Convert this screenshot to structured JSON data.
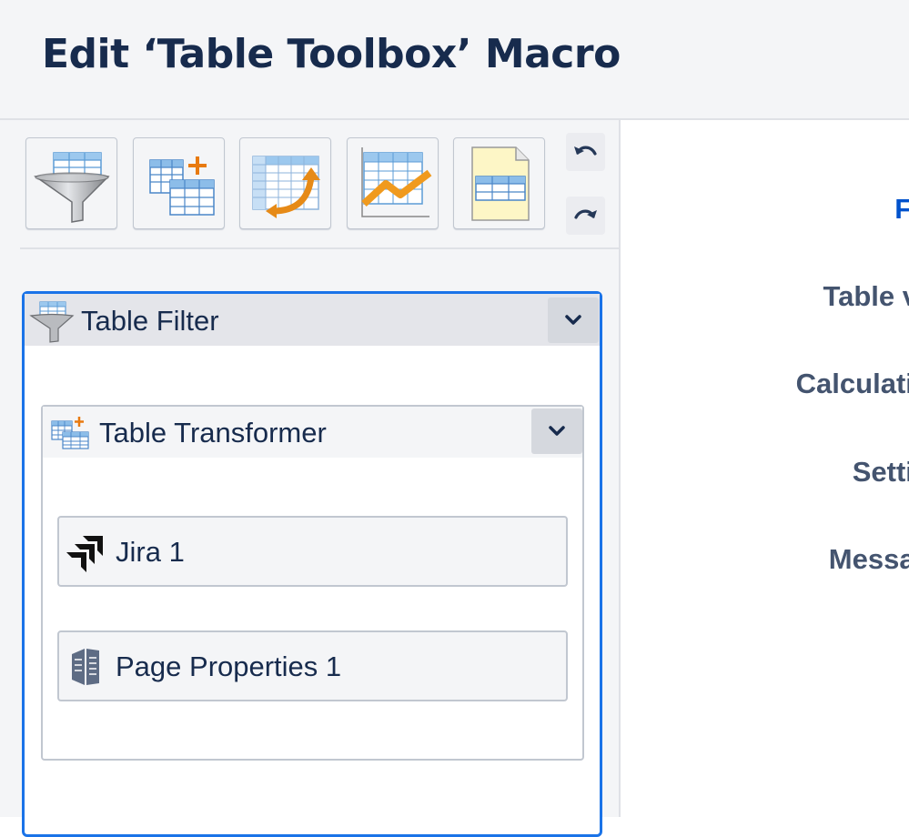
{
  "dialog": {
    "title": "Edit ‘Table Toolbox’ Macro"
  },
  "toolbar": {
    "buttons": [
      {
        "icon": "funnel-table-icon",
        "action": "add-table-filter"
      },
      {
        "icon": "table-plus-icon",
        "action": "add-table-transformer"
      },
      {
        "icon": "table-pivot-icon",
        "action": "add-pivot-table"
      },
      {
        "icon": "table-chart-icon",
        "action": "add-table-chart"
      },
      {
        "icon": "table-document-icon",
        "action": "add-table-spreadsheet"
      }
    ],
    "undo_icon": "undo-icon",
    "redo_icon": "redo-icon"
  },
  "tree": {
    "filter": {
      "label": "Table Filter",
      "icon": "funnel-table-icon"
    },
    "transformer": {
      "label": "Table Transformer",
      "icon": "table-plus-icon"
    },
    "sources": [
      {
        "label": "Jira 1",
        "icon": "jira-icon"
      },
      {
        "label": "Page Properties 1",
        "icon": "page-properties-icon"
      }
    ]
  },
  "sidebar": {
    "items": [
      {
        "label": "Filter",
        "active": true
      },
      {
        "label": "Table view",
        "active": false
      },
      {
        "label": "Calculations",
        "active": false
      },
      {
        "label": "Settings",
        "active": false
      },
      {
        "label": "Messages",
        "active": false
      }
    ]
  },
  "colors": {
    "accent": "#0052cc",
    "selected_border": "#1a73e8"
  }
}
